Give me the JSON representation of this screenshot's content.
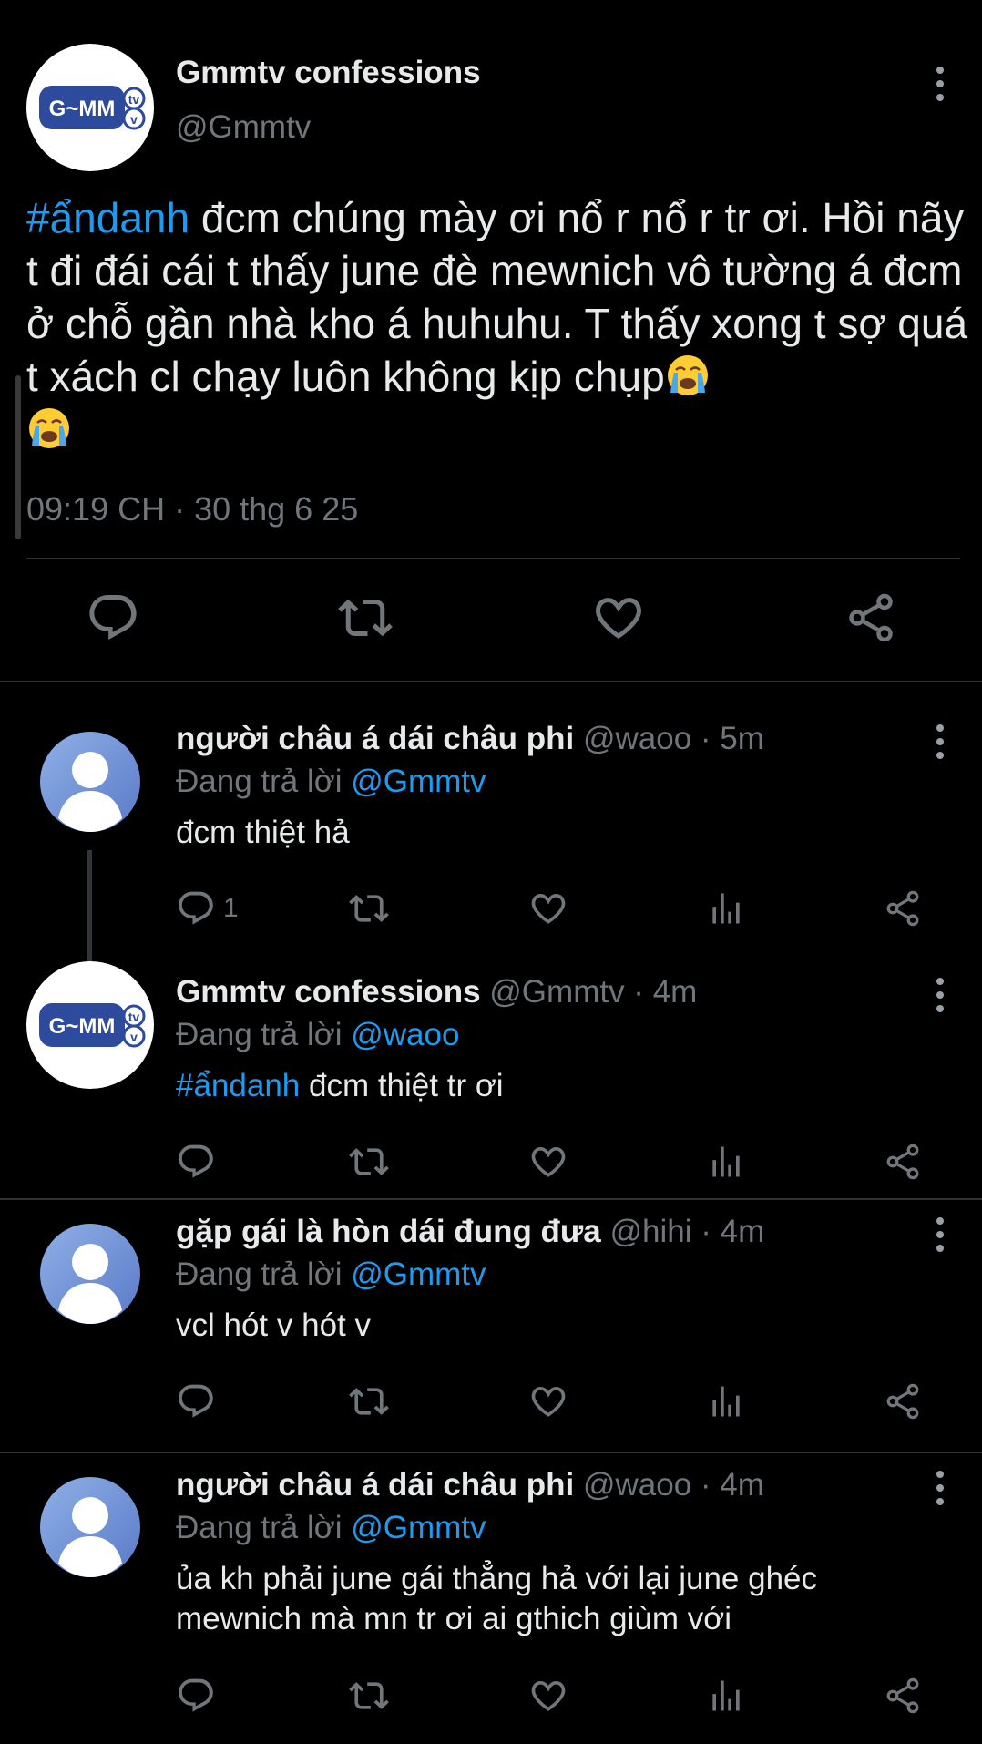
{
  "main_tweet": {
    "display_name": "Gmmtv confessions",
    "handle": "@Gmmtv",
    "hashtag": "#ẩndanh",
    "text": " đcm chúng mày ơi nổ r nổ r tr ơi. Hồi nãy t đi đái cái t thấy june đè mewnich vô tường á đcm ở chỗ gần nhà kho á huhuhu. T thấy xong t sợ quá t xách cl chạy luôn không kịp chụp",
    "timestamp": "09:19 CH · 30 thg 6 25",
    "actions": [
      "reply-icon",
      "retweet-icon",
      "like-icon",
      "share-icon"
    ]
  },
  "replies": [
    {
      "display_name": "người châu á dái châu phi",
      "handle": "@waoo",
      "time": "5m",
      "replying_label": "Đang trả lời",
      "replying_to": "@Gmmtv",
      "hashtag": "",
      "text": "đcm thiệt hả",
      "reply_count": "1"
    },
    {
      "display_name": "Gmmtv confessions",
      "handle": "@Gmmtv",
      "time": "4m",
      "replying_label": "Đang trả lời",
      "replying_to": "@waoo",
      "hashtag": "#ẩndanh",
      "text": " đcm thiệt tr ơi",
      "reply_count": ""
    },
    {
      "display_name": "gặp gái là hòn dái đung đưa",
      "handle": "@hihi",
      "time": "4m",
      "replying_label": "Đang trả lời",
      "replying_to": "@Gmmtv",
      "hashtag": "",
      "text": "vcl hót v hót v",
      "reply_count": ""
    },
    {
      "display_name": "người châu á dái châu phi",
      "handle": "@waoo",
      "time": "4m",
      "replying_label": "Đang trả lời",
      "replying_to": "@Gmmtv",
      "hashtag": "",
      "text": "ủa kh phải june gái thẳng hả với lại june ghéc mewnich mà mn tr ơi ai gthich giùm với",
      "reply_count": ""
    }
  ],
  "logo_text": "G~MM",
  "logo_badge": "tv",
  "dot_sep": " · ",
  "colors": {
    "background": "#000000",
    "accent": "#1d9bf0",
    "muted": "#71767b",
    "text": "#e7e9ea",
    "divider": "#2f3336"
  }
}
